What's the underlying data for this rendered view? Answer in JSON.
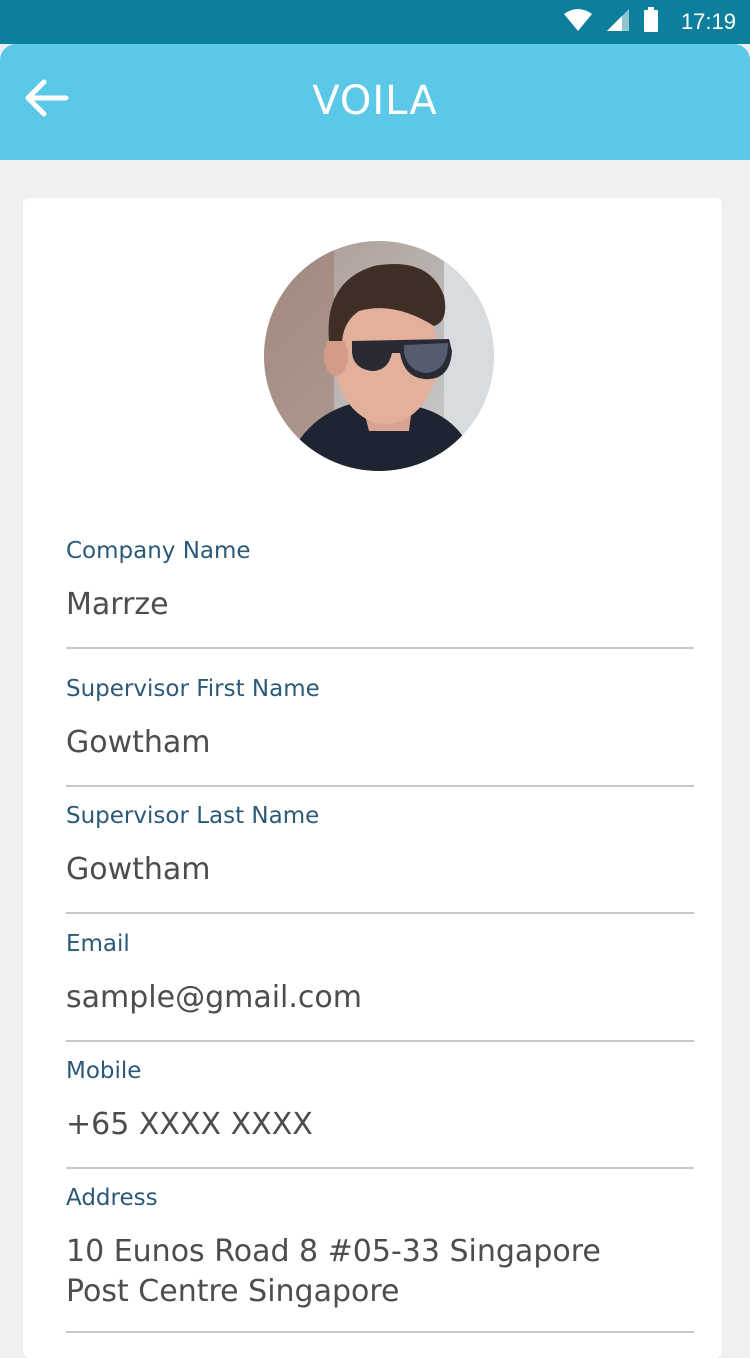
{
  "status_bar": {
    "time": "17:19",
    "icons": [
      "wifi-icon",
      "signal-icon",
      "battery-icon"
    ]
  },
  "app_bar": {
    "title": "VOILA",
    "back_icon": "arrow-left-icon"
  },
  "profile": {
    "avatar": "profile-photo"
  },
  "fields": {
    "company_name": {
      "label": "Company Name",
      "value": "Marrze"
    },
    "supervisor_first_name": {
      "label": "Supervisor First Name",
      "value": "Gowtham"
    },
    "supervisor_last_name": {
      "label": "Supervisor Last Name",
      "value": "Gowtham"
    },
    "email": {
      "label": "Email",
      "value": "sample@gmail.com"
    },
    "mobile": {
      "label": "Mobile",
      "value": "+65 XXXX XXXX"
    },
    "address": {
      "label": "Address",
      "line1": "10 Eunos Road 8 #05-33 Singapore",
      "line2": "Post Centre Singapore"
    }
  },
  "colors": {
    "status_bar": "#0b7f9c",
    "app_bar": "#5bc8e8",
    "label": "#2b5a78",
    "value": "#4d4d4d",
    "background": "#f0f0f0"
  }
}
